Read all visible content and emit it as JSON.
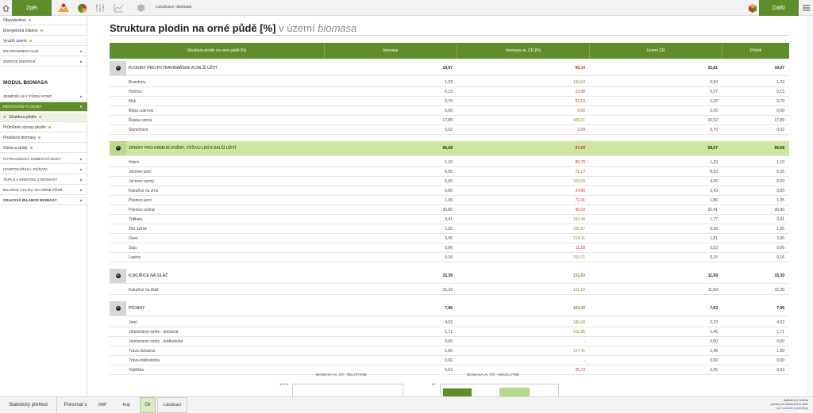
{
  "topbar": {
    "back_label": "Zpět",
    "location_prefix": "Lokalizace:",
    "location_value": "biomasa",
    "next_label": "Další"
  },
  "sidebar": {
    "top_items": [
      {
        "label": "Obyvatelstvo"
      },
      {
        "label": "Energetická bilance"
      },
      {
        "label": "Využití území"
      },
      {
        "label": "ENVIRONMENTÁLNÍ"
      },
      {
        "label": "ZDROJE ENERGIE"
      }
    ],
    "module_title": "MODUL BIOMASA",
    "module_items": [
      {
        "label": "ZEMĚDĚLSKÝ PŮDNÍ FOND"
      },
      {
        "label": "PĚSTOVÁNÍ PLODINY"
      },
      {
        "label": "Struktura plodin"
      },
      {
        "label": "Průměrné výnosy plodin"
      },
      {
        "label": "Produkce biomasy"
      },
      {
        "label": "Osiva a ztráty"
      },
      {
        "label": "POTRAVINOVÁ SOBĚSTAČNOST"
      },
      {
        "label": "HOSPODÁŘSKÁ ZVÍŘATA"
      },
      {
        "label": "TEPLO A ENERGIE Z BIOMASY"
      },
      {
        "label": "BILANCE UHLÍKU NA ORNÉ PŮDĚ"
      },
      {
        "label": "CELKOVÁ BILANCE BIOMASY"
      }
    ]
  },
  "main": {
    "title": "Struktura plodin na orné půdě [%]",
    "title_sub": "v území",
    "title_em": "biomasa"
  },
  "table": {
    "headers": [
      "Struktura plodin na orné půdě [%]",
      "biomasa",
      "biomasa vs. ČR [%]",
      "Území ČR",
      "Průnik"
    ],
    "groups": [
      {
        "label": "PLODINY PRO POTRAVINÁŘSKÉ A DALŠÍ UŽITÍ",
        "values": [
          "19,97",
          "88,34",
          "22,61",
          "19,97"
        ],
        "rows": [
          {
            "label": "Brambory",
            "v1": "1,23",
            "v2": "130,62",
            "v3": "0,94",
            "v4": "1,23"
          },
          {
            "label": "Hořčice",
            "v1": "0,13",
            "v2": "22,68",
            "v3": "0,57",
            "v4": "0,13"
          },
          {
            "label": "Mák",
            "v1": "0,70",
            "v2": "53,13",
            "v3": "1,32",
            "v4": "0,70"
          },
          {
            "label": "Řepa cukrová",
            "v1": "0,00",
            "v2": "0,00",
            "v3": "2,55",
            "v4": "0,00"
          },
          {
            "label": "Řepka ozimá",
            "v1": "17,89",
            "v2": "108,21",
            "v3": "16,52",
            "v4": "17,89"
          },
          {
            "label": "Slunečnice",
            "v1": "0,02",
            "v2": "2,84",
            "v3": "0,70",
            "v4": "0,02"
          }
        ]
      },
      {
        "label": "ZRNINY PRO KRMENÍ ZVÍŘAT, VÝŽIVU LIDÍ A DALŠÍ UŽITÍ",
        "values": [
          "56,68",
          "97,60",
          "58,07",
          "56,68"
        ],
        "rows": [
          {
            "label": "Hrách",
            "v1": "1,10",
            "v2": "89,78",
            "v3": "1,23",
            "v4": "1,10"
          },
          {
            "label": "Ječmen jarní",
            "v1": "6,05",
            "v2": "72,17",
            "v3": "8,83",
            "v4": "6,05"
          },
          {
            "label": "Ječmen ozimý",
            "v1": "6,50",
            "v2": "152,59",
            "v3": "4,26",
            "v4": "6,50"
          },
          {
            "label": "Kukuřice na zrno",
            "v1": "0,85",
            "v2": "24,80",
            "v3": "3,43",
            "v4": "0,85"
          },
          {
            "label": "Pšenice jarní",
            "v1": "1,35",
            "v2": "72,41",
            "v3": "1,86",
            "v4": "1,35"
          },
          {
            "label": "Pšenice ozimá",
            "v1": "30,80",
            "v2": "95,03",
            "v3": "32,41",
            "v4": "30,80"
          },
          {
            "label": "Tritikale",
            "v1": "3,41",
            "v2": "192,48",
            "v3": "1,77",
            "v4": "3,41"
          },
          {
            "label": "Žito ozimé",
            "v1": "1,55",
            "v2": "156,87",
            "v3": "0,99",
            "v4": "1,55"
          },
          {
            "label": "Oves",
            "v1": "3,95",
            "v2": "218,11",
            "v3": "1,81",
            "v4": "3,95"
          },
          {
            "label": "Sója",
            "v1": "0,06",
            "v2": "11,28",
            "v3": "0,53",
            "v4": "0,06"
          },
          {
            "label": "Lupina",
            "v1": "0,16",
            "v2": "103,71",
            "v3": "0,15",
            "v4": "0,16"
          }
        ]
      },
      {
        "label": "KUKUŘICE NA SILÁŽ",
        "values": [
          "15,39",
          "131,63",
          "11,69",
          "15,39"
        ],
        "rows": [
          {
            "label": "Kukuřice na siláž",
            "v1": "15,39",
            "v2": "131,63",
            "v3": "11,69",
            "v4": "15,39"
          }
        ]
      },
      {
        "label": "PÍCNINY",
        "values": [
          "7,96",
          "104,32",
          "7,63",
          "7,96"
        ],
        "rows": [
          {
            "label": "Jetel",
            "v1": "4,02",
            "v2": "180,28",
            "v3": "2,23",
            "v4": "4,02"
          },
          {
            "label": "Jetelotravní směs - dočasná",
            "v1": "1,71",
            "v2": "116,85",
            "v3": "1,46",
            "v4": "1,71"
          },
          {
            "label": "Jetelotravní směs - krátkodobá",
            "v1": "0,00",
            "v2": "-",
            "v3": "0,00",
            "v4": "0,00"
          },
          {
            "label": "Tráva dočasná",
            "v1": "1,60",
            "v2": "107,41",
            "v3": "1,48",
            "v4": "1,60"
          },
          {
            "label": "Tráva krátkodobá",
            "v1": "0,00",
            "v2": "-",
            "v3": "0,00",
            "v4": "0,00"
          },
          {
            "label": "Vojtěška",
            "v1": "0,63",
            "v2": "25,73",
            "v3": "2,45",
            "v4": "0,63"
          }
        ]
      }
    ]
  },
  "charts": {
    "left_title": "BIOMASA vs. ČR - RELATIVNĚ",
    "left_tick": "120 %",
    "right_title": "BIOMASA vs. ČR - ABSOLUTNĚ",
    "right_tick": "60"
  },
  "bottombar": {
    "overview": "Statistický přehled",
    "compare": "Porovnat s",
    "orp": "ORP",
    "kraj": "Kraj",
    "cr": "ČR",
    "lokalizaci": "Lokalizací",
    "note_l1": "Aplikace je určena",
    "note_l2": "pouze pro nekomerční užití.",
    "note_link": "(viz Licenční podmínky)"
  },
  "colors": {
    "accent": "#5e8e2a",
    "positive": "#6c9e28",
    "negative": "#c0392b",
    "highlight": "#cfe6a0"
  }
}
